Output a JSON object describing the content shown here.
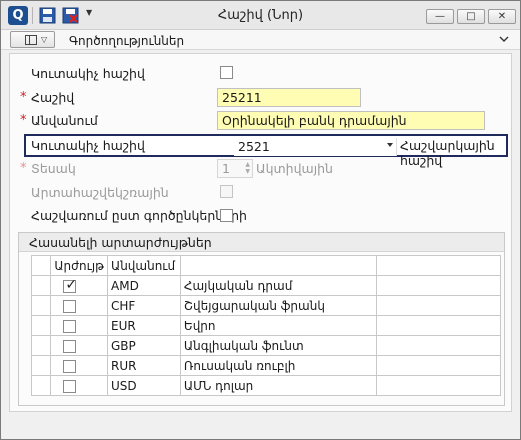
{
  "window": {
    "title": "Հաշիվ (Նոր)",
    "app_icon": "Q",
    "icons": [
      "save-icon",
      "cancel-icon"
    ],
    "controls": {
      "minimize": "—",
      "maximize": "□",
      "close": "✕"
    }
  },
  "toolbar": {
    "operations_label": "Գործողություններ"
  },
  "form": {
    "accumulative_label": "Կուտակիչ հաշիվ",
    "account_label": "Հաշիվ",
    "account_value": "25211",
    "name_label": "Անվանում",
    "name_value": "Օրինակելի բանկ դրամային",
    "accum_account_label": "Կուտակիչ հաշիվ",
    "accum_account_value": "2521",
    "accum_account_desc": "Հաշվարկային հաշիվ",
    "type_label": "Տեսակ",
    "type_value": "1",
    "type_desc": "Ակտիվային",
    "offbalance_label": "Արտահաշվեկշռային",
    "by_partners_label": "Հաշվառում ըստ գործընկերների"
  },
  "currencies": {
    "group_title": "Հասանելի արտարժույթներ",
    "columns": [
      "",
      "Արժույթ",
      "Անվանում",
      ""
    ],
    "rows": [
      {
        "checked": true,
        "code": "AMD",
        "name": "Հայկական դրամ"
      },
      {
        "checked": false,
        "code": "CHF",
        "name": "Շվեյցարական ֆրանկ"
      },
      {
        "checked": false,
        "code": "EUR",
        "name": "Եվրո"
      },
      {
        "checked": false,
        "code": "GBP",
        "name": "Անգլիական ֆունտ"
      },
      {
        "checked": false,
        "code": "RUR",
        "name": "Ռուսական ռուբլի"
      },
      {
        "checked": false,
        "code": "USD",
        "name": "ԱՄՆ դոլար"
      }
    ]
  },
  "colors": {
    "required": "#d02020",
    "highlight_border": "#1f2b5c",
    "input_yellow": "#fffcb3"
  }
}
